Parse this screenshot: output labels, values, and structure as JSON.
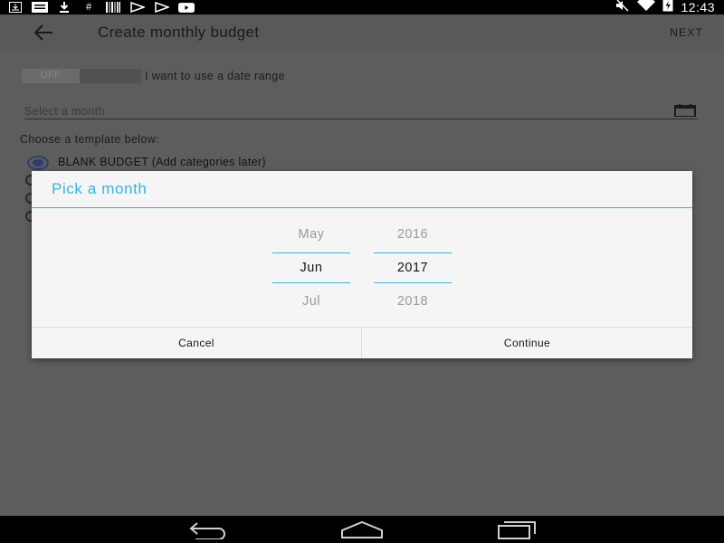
{
  "status_bar": {
    "time": "12:43",
    "left_icons": [
      "download-box-icon",
      "message-icon",
      "download-icon",
      "hash-icon",
      "barcode-icon",
      "play-store-icon",
      "play-store-icon",
      "youtube-icon"
    ],
    "right_icons": [
      "mute-icon",
      "wifi-icon",
      "battery-icon"
    ]
  },
  "app_bar": {
    "title": "Create monthly budget",
    "next_label": "NEXT"
  },
  "form": {
    "toggle_state": "OFF",
    "date_range_label": "I want to use a date range",
    "month_placeholder": "Select a month",
    "template_heading": "Choose a template below:",
    "template_selected": "BLANK BUDGET (Add categories later)"
  },
  "dialog": {
    "title": "Pick a month",
    "month": {
      "prev": "May",
      "current": "Jun",
      "next": "Jul"
    },
    "year": {
      "prev": "2016",
      "current": "2017",
      "next": "2018"
    },
    "cancel_label": "Cancel",
    "continue_label": "Continue"
  },
  "colors": {
    "accent": "#33b5e5",
    "dim_overlay_bg": "#5d5d5d",
    "radio_accent": "#2d3d6e"
  }
}
